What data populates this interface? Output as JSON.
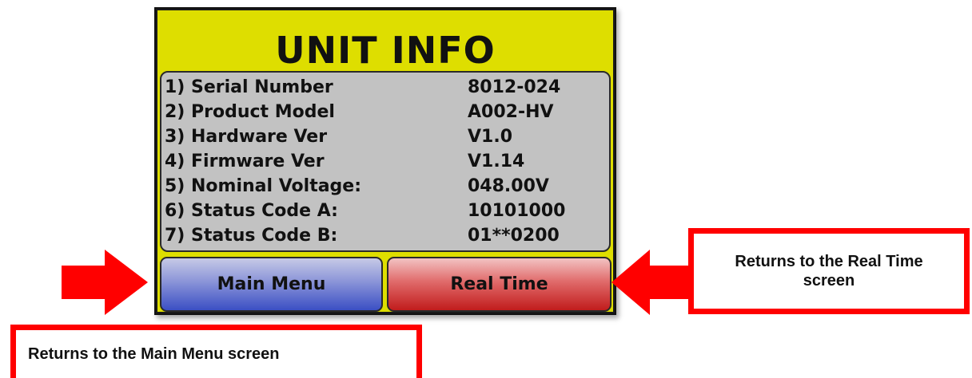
{
  "screen": {
    "title": "UNIT INFO",
    "rows": [
      {
        "label": "1) Serial Number",
        "value": "8012-024"
      },
      {
        "label": "2) Product Model",
        "value": "A002-HV"
      },
      {
        "label": "3) Hardware Ver",
        "value": "V1.0"
      },
      {
        "label": "4) Firmware Ver",
        "value": "V1.14"
      },
      {
        "label": "5) Nominal Voltage:",
        "value": "048.00V"
      },
      {
        "label": "6) Status Code A:",
        "value": "10101000"
      },
      {
        "label": "7) Status Code B:",
        "value": "01**0200"
      }
    ],
    "buttons": {
      "main_menu": "Main Menu",
      "real_time": "Real Time"
    }
  },
  "callouts": {
    "real_time": "Returns to the Real Time screen",
    "main_menu": "Returns to the Main Menu screen"
  },
  "colors": {
    "title_bar": "#dede00",
    "info_panel": "#c2c2c2",
    "main_menu_button": "#3b4fc4",
    "real_time_button": "#c11c1c",
    "annotation_red": "#ff0000"
  },
  "icons": {
    "left_arrow": "right-pointing-arrow-icon",
    "right_arrow": "left-pointing-arrow-icon"
  }
}
